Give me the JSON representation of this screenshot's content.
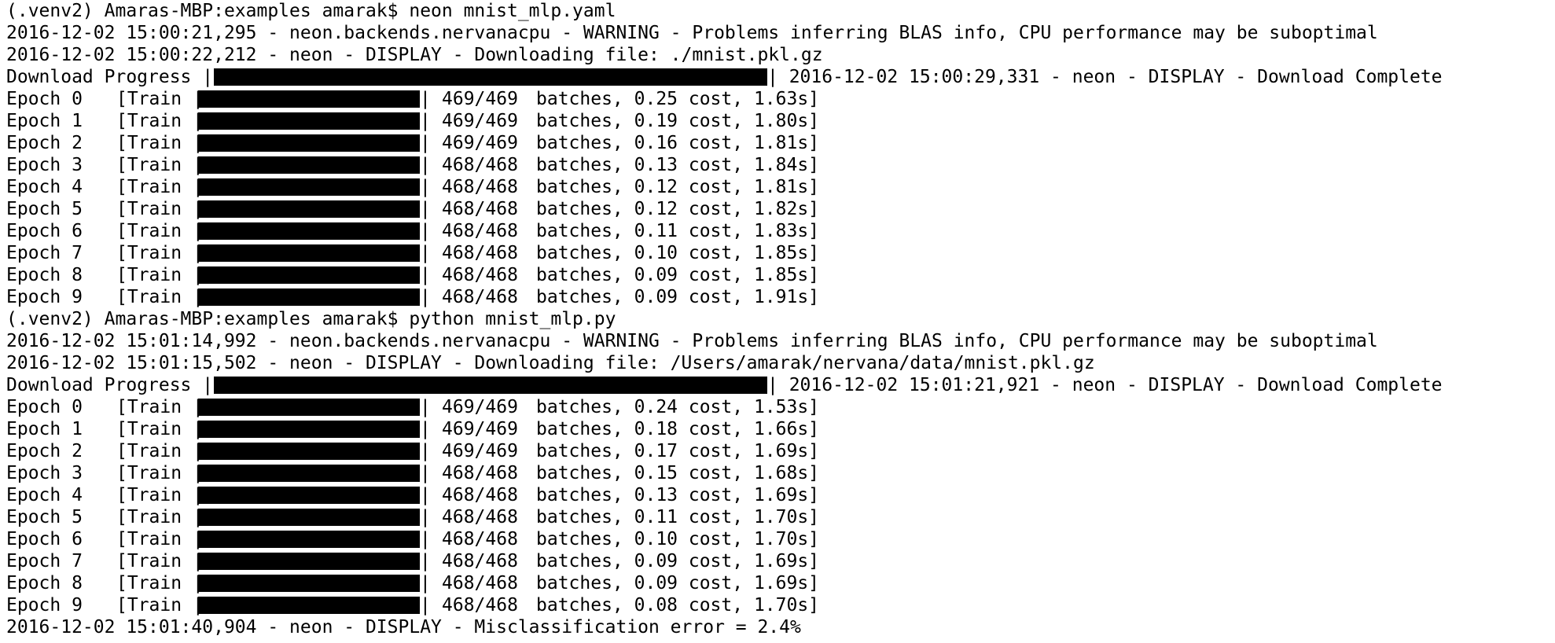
{
  "terminal": {
    "sessions": [
      {
        "prompt": "(.venv2) Amaras-MBP:examples amarak$ neon mnist_mlp.yaml",
        "warning": "2016-12-02 15:00:21,295 - neon.backends.nervanacpu - WARNING - Problems inferring BLAS info, CPU performance may be suboptimal",
        "downloading": "2016-12-02 15:00:22,212 - neon - DISPLAY - Downloading file: ./mnist.pkl.gz",
        "download_label": "Download Progress |",
        "download_complete": "| 2016-12-02 15:00:29,331 - neon - DISPLAY - Download Complete",
        "download_progress": 1.0,
        "epochs": [
          {
            "epoch": "Epoch 0",
            "train": "[Train |",
            "batches": "469/469",
            "rest": "batches, 0.25 cost, 1.63s]",
            "progress": 1.0
          },
          {
            "epoch": "Epoch 1",
            "train": "[Train |",
            "batches": "469/469",
            "rest": "batches, 0.19 cost, 1.80s]",
            "progress": 1.0
          },
          {
            "epoch": "Epoch 2",
            "train": "[Train |",
            "batches": "469/469",
            "rest": "batches, 0.16 cost, 1.81s]",
            "progress": 1.0
          },
          {
            "epoch": "Epoch 3",
            "train": "[Train |",
            "batches": "468/468",
            "rest": "batches, 0.13 cost, 1.84s]",
            "progress": 1.0
          },
          {
            "epoch": "Epoch 4",
            "train": "[Train |",
            "batches": "468/468",
            "rest": "batches, 0.12 cost, 1.81s]",
            "progress": 1.0
          },
          {
            "epoch": "Epoch 5",
            "train": "[Train |",
            "batches": "468/468",
            "rest": "batches, 0.12 cost, 1.82s]",
            "progress": 1.0
          },
          {
            "epoch": "Epoch 6",
            "train": "[Train |",
            "batches": "468/468",
            "rest": "batches, 0.11 cost, 1.83s]",
            "progress": 1.0
          },
          {
            "epoch": "Epoch 7",
            "train": "[Train |",
            "batches": "468/468",
            "rest": "batches, 0.10 cost, 1.85s]",
            "progress": 1.0
          },
          {
            "epoch": "Epoch 8",
            "train": "[Train |",
            "batches": "468/468",
            "rest": "batches, 0.09 cost, 1.85s]",
            "progress": 1.0
          },
          {
            "epoch": "Epoch 9",
            "train": "[Train |",
            "batches": "468/468",
            "rest": "batches, 0.09 cost, 1.91s]",
            "progress": 1.0
          }
        ]
      },
      {
        "prompt": "(.venv2) Amaras-MBP:examples amarak$ python mnist_mlp.py",
        "warning": "2016-12-02 15:01:14,992 - neon.backends.nervanacpu - WARNING - Problems inferring BLAS info, CPU performance may be suboptimal",
        "downloading": "2016-12-02 15:01:15,502 - neon - DISPLAY - Downloading file: /Users/amarak/nervana/data/mnist.pkl.gz",
        "download_label": "Download Progress |",
        "download_complete": "| 2016-12-02 15:01:21,921 - neon - DISPLAY - Download Complete",
        "download_progress": 1.0,
        "epochs": [
          {
            "epoch": "Epoch 0",
            "train": "[Train |",
            "batches": "469/469",
            "rest": "batches, 0.24 cost, 1.53s]",
            "progress": 1.0
          },
          {
            "epoch": "Epoch 1",
            "train": "[Train |",
            "batches": "469/469",
            "rest": "batches, 0.18 cost, 1.66s]",
            "progress": 1.0
          },
          {
            "epoch": "Epoch 2",
            "train": "[Train |",
            "batches": "469/469",
            "rest": "batches, 0.17 cost, 1.69s]",
            "progress": 1.0
          },
          {
            "epoch": "Epoch 3",
            "train": "[Train |",
            "batches": "468/468",
            "rest": "batches, 0.15 cost, 1.68s]",
            "progress": 1.0
          },
          {
            "epoch": "Epoch 4",
            "train": "[Train |",
            "batches": "468/468",
            "rest": "batches, 0.13 cost, 1.69s]",
            "progress": 1.0
          },
          {
            "epoch": "Epoch 5",
            "train": "[Train |",
            "batches": "468/468",
            "rest": "batches, 0.11 cost, 1.70s]",
            "progress": 1.0
          },
          {
            "epoch": "Epoch 6",
            "train": "[Train |",
            "batches": "468/468",
            "rest": "batches, 0.10 cost, 1.70s]",
            "progress": 1.0
          },
          {
            "epoch": "Epoch 7",
            "train": "[Train |",
            "batches": "468/468",
            "rest": "batches, 0.09 cost, 1.69s]",
            "progress": 1.0
          },
          {
            "epoch": "Epoch 8",
            "train": "[Train |",
            "batches": "468/468",
            "rest": "batches, 0.09 cost, 1.69s]",
            "progress": 1.0
          },
          {
            "epoch": "Epoch 9",
            "train": "[Train |",
            "batches": "468/468",
            "rest": "batches, 0.08 cost, 1.70s]",
            "progress": 1.0
          }
        ]
      }
    ],
    "final_line": "2016-12-02 15:01:40,904 - neon - DISPLAY - Misclassification error = 2.4%"
  },
  "colors": {
    "background": "#ffffff",
    "text": "#000000",
    "progress_bar": "#000000"
  }
}
